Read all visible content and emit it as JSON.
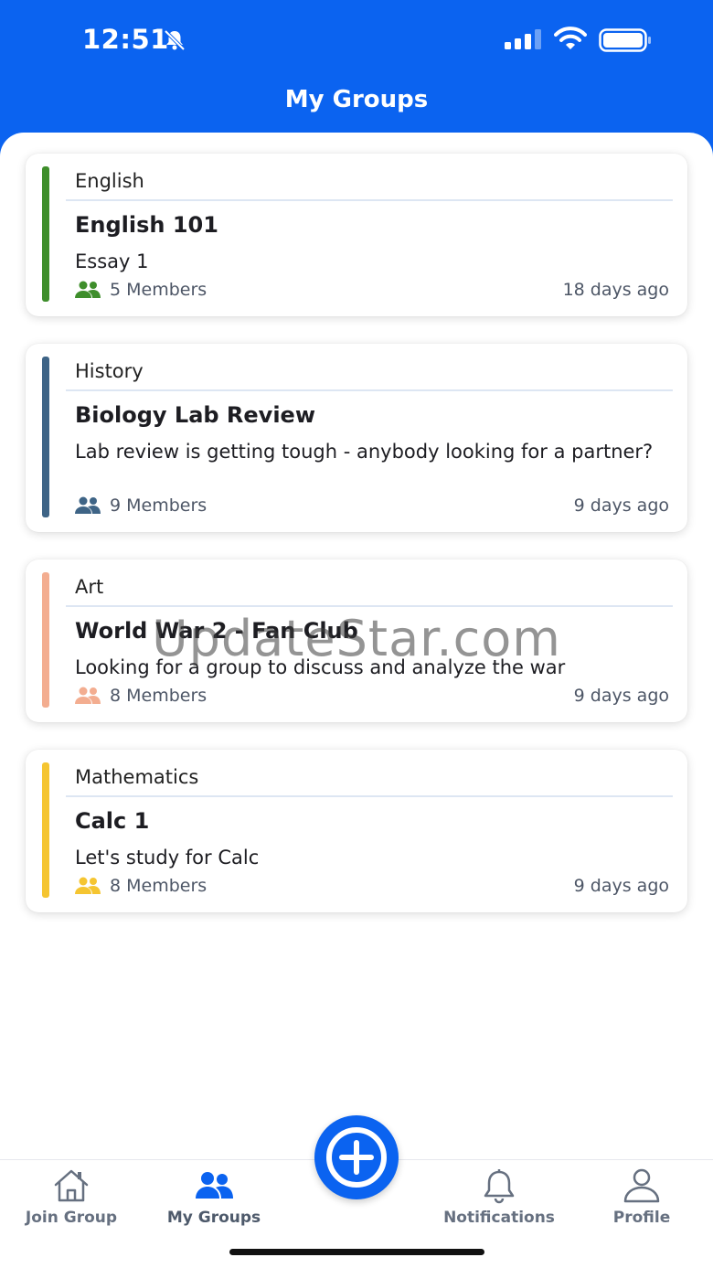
{
  "status_bar": {
    "time": "12:51",
    "icons": [
      "bell-slash-icon",
      "cellular-signal-icon",
      "wifi-icon",
      "battery-icon"
    ]
  },
  "header": {
    "title": "My Groups"
  },
  "groups": [
    {
      "category": "English",
      "title": "English 101",
      "description": "Essay 1",
      "members": "5 Members",
      "time_ago": "18 days ago",
      "accent_color": "#3e8e2b"
    },
    {
      "category": "History",
      "title": "Biology Lab Review",
      "description": "Lab review is getting tough - anybody looking for a partner?",
      "members": "9 Members",
      "time_ago": "9 days ago",
      "accent_color": "#3e6486"
    },
    {
      "category": "Art",
      "title": "World War 2 - Fan Club",
      "description": "Looking for a group to discuss and analyze the war",
      "members": "8 Members",
      "time_ago": "9 days ago",
      "accent_color": "#f3ad90"
    },
    {
      "category": "Mathematics",
      "title": "Calc 1",
      "description": "Let's study for Calc",
      "members": "8 Members",
      "time_ago": "9 days ago",
      "accent_color": "#f5c531"
    }
  ],
  "watermark": "UpdateStar.com",
  "tabbar": {
    "tabs": [
      {
        "label": "Join Group",
        "icon": "home-icon"
      },
      {
        "label": "My Groups",
        "icon": "users-icon",
        "active": true
      },
      {
        "label": "Notifications",
        "icon": "bell-icon"
      },
      {
        "label": "Profile",
        "icon": "user-icon"
      }
    ],
    "fab_icon": "plus-circle-icon"
  },
  "colors": {
    "primary": "#0b63f0",
    "muted_text": "#4d5666"
  }
}
